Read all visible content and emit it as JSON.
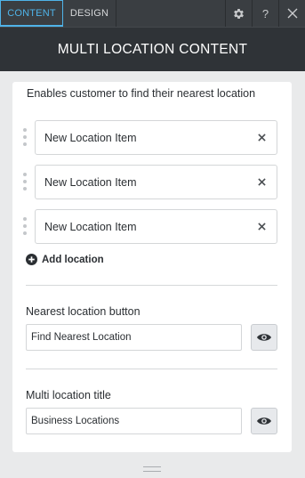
{
  "tabs": {
    "content": "CONTENT",
    "design": "DESIGN"
  },
  "toolbar": {
    "settings_icon": "gear-icon",
    "help_label": "?",
    "close_icon": "close-icon"
  },
  "header": {
    "title": "MULTI LOCATION CONTENT"
  },
  "panel": {
    "description": "Enables customer to find their nearest location",
    "items": [
      {
        "label": "New Location Item"
      },
      {
        "label": "New Location Item"
      },
      {
        "label": "New Location Item"
      }
    ],
    "add_location": "Add location",
    "nearest_button": {
      "label": "Nearest location button",
      "value": "Find Nearest Location"
    },
    "multi_title": {
      "label": "Multi location title",
      "value": "Business Locations"
    }
  },
  "colors": {
    "accent": "#4fb3e8",
    "header_bg": "#2f3337",
    "topbar_bg": "#3a3e42"
  }
}
